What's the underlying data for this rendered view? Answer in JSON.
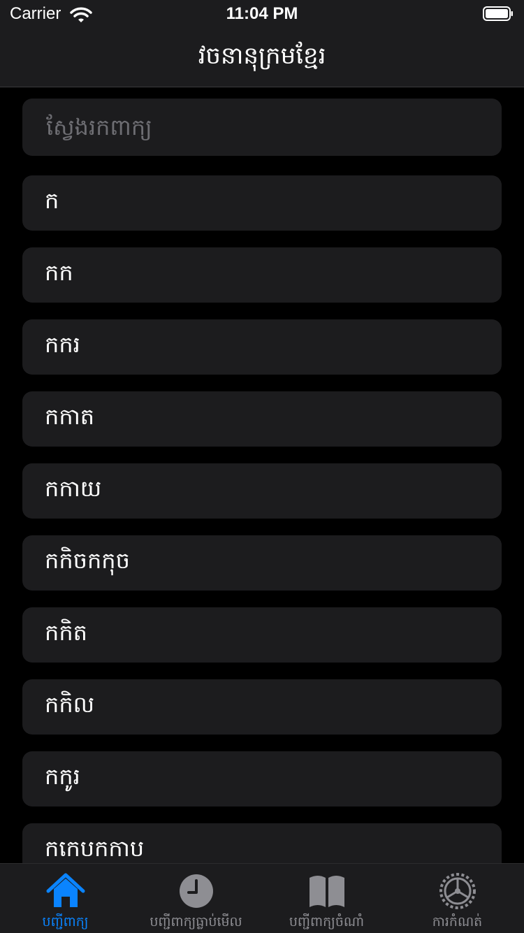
{
  "status_bar": {
    "carrier": "Carrier",
    "time": "11:04 PM"
  },
  "nav": {
    "title": "វចនានុក្រមខ្មែរ"
  },
  "search": {
    "placeholder": "ស្វែងរកពាក្យ"
  },
  "words": [
    "ក",
    "កក",
    "កករ",
    "កកាត",
    "កកាយ",
    "កកិចកកុច",
    "កកិត",
    "កកិល",
    "កកូរ",
    "កកេបកកាប"
  ],
  "tabs": [
    {
      "label": "បញ្ជីពាក្យ",
      "icon": "home-icon",
      "active": true
    },
    {
      "label": "បញ្ជីពាក្យធ្លាប់មើល",
      "icon": "clock-icon",
      "active": false
    },
    {
      "label": "បញ្ជីពាក្យចំណាំ",
      "icon": "book-icon",
      "active": false
    },
    {
      "label": "ការកំណត់",
      "icon": "gear-icon",
      "active": false
    }
  ],
  "colors": {
    "accent": "#0a84ff",
    "inactive": "#8e8e93",
    "cell": "#1c1c1e",
    "background": "#000000"
  }
}
